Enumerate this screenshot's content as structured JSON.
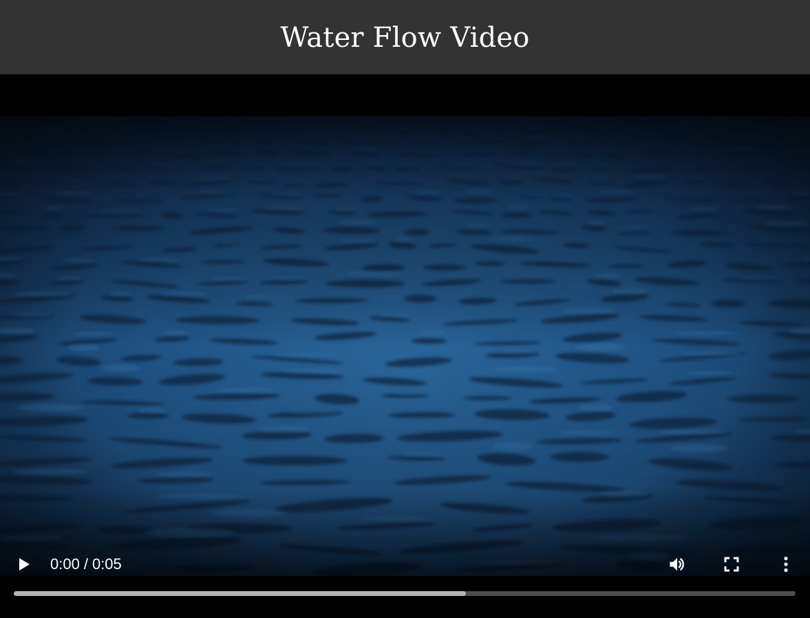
{
  "header": {
    "title": "Water Flow Video"
  },
  "video_player": {
    "current_time": "0:00",
    "separator": "/",
    "duration": "0:05",
    "buffered_fraction": 0.578,
    "controls": {
      "play_icon": "play-icon",
      "volume_icon": "volume-icon",
      "fullscreen_icon": "fullscreen-icon",
      "more_icon": "more-vert-icon"
    }
  },
  "colors": {
    "header_background": "#333333",
    "player_background": "#000000",
    "water_tone": "#1d4b74",
    "timeline_track": "#4d4d4d",
    "timeline_buffered": "#b3b3b3"
  }
}
